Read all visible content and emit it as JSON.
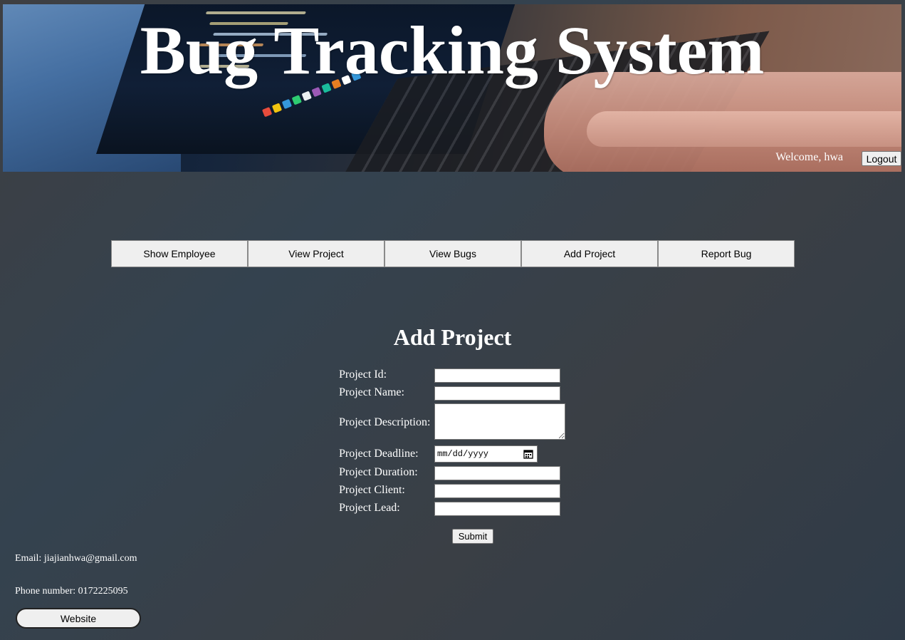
{
  "header": {
    "title": "Bug Tracking System",
    "welcome": "Welcome, hwa",
    "logout_label": "Logout"
  },
  "nav": {
    "items": [
      {
        "label": "Show Employee"
      },
      {
        "label": "View Project"
      },
      {
        "label": "View Bugs"
      },
      {
        "label": "Add Project"
      },
      {
        "label": "Report Bug"
      }
    ]
  },
  "form": {
    "title": "Add Project",
    "fields": {
      "project_id": {
        "label": "Project Id:",
        "value": ""
      },
      "project_name": {
        "label": "Project Name:",
        "value": ""
      },
      "project_description": {
        "label": "Project Description:",
        "value": ""
      },
      "project_deadline": {
        "label": "Project Deadline:",
        "placeholder": "mm/dd/yyyy"
      },
      "project_duration": {
        "label": "Project Duration:",
        "value": ""
      },
      "project_client": {
        "label": "Project Client:",
        "value": ""
      },
      "project_lead": {
        "label": "Project Lead:",
        "value": ""
      }
    },
    "submit_label": "Submit"
  },
  "footer": {
    "email": "Email: jiajianhwa@gmail.com",
    "phone": "Phone number: 0172225095",
    "website_label": "Website"
  }
}
